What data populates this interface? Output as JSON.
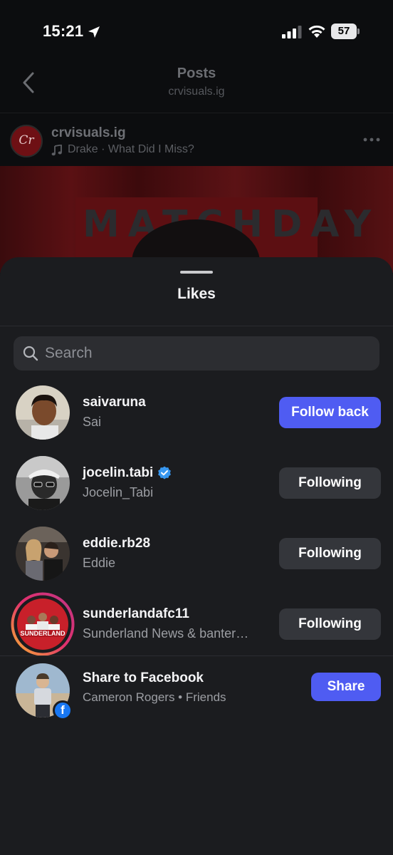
{
  "status_bar": {
    "time": "15:21",
    "battery": "57",
    "icons": [
      "location-arrow-icon",
      "signal-icon",
      "wifi-icon",
      "battery-icon"
    ]
  },
  "header": {
    "title": "Posts",
    "subtitle": "crvisuals.ig",
    "back_icon": "chevron-left-icon"
  },
  "post": {
    "username": "crvisuals.ig",
    "song": "Drake · What Did I Miss?",
    "avatar_text": "Cr",
    "poster_text": "MATCHDAY"
  },
  "likes_sheet": {
    "title": "Likes",
    "search": {
      "placeholder": "Search"
    },
    "users": [
      {
        "username": "saivaruna",
        "name": "Sai",
        "button": "Follow back",
        "verified": false
      },
      {
        "username": "jocelin.tabi",
        "name": "Jocelin_Tabi",
        "button": "Following",
        "verified": true
      },
      {
        "username": "eddie.rb28",
        "name": "Eddie",
        "button": "Following",
        "verified": false
      },
      {
        "username": "sunderlandafc11",
        "name": "Sunderland News & banter…",
        "button": "Following",
        "verified": false
      }
    ],
    "share": {
      "title": "Share to Facebook",
      "subtitle": "Cameron Rogers • Friends",
      "button": "Share"
    }
  },
  "colors": {
    "accent": "#4f5cf2",
    "sheet_bg": "#1b1c1f",
    "button_bg": "#34363b",
    "verified": "#3797f0",
    "facebook": "#1877f2"
  }
}
